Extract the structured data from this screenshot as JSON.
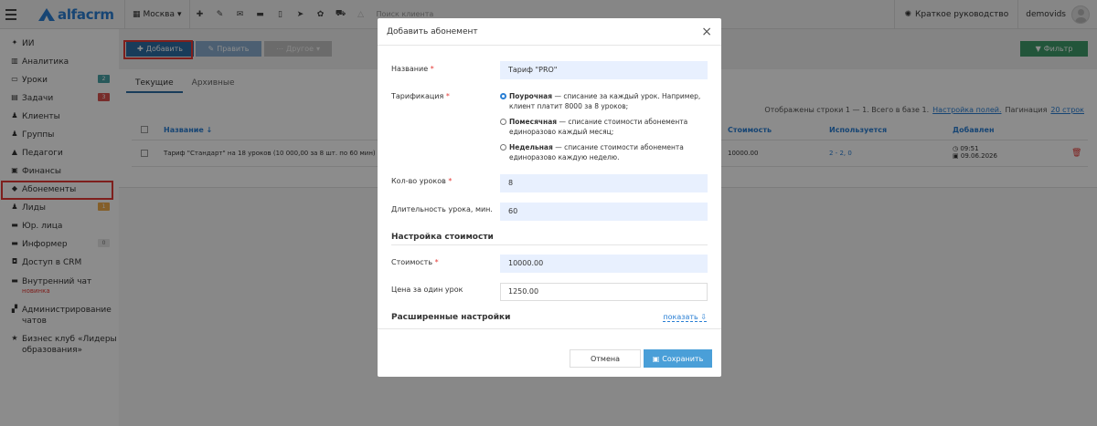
{
  "header": {
    "logo_text": "alfacrm",
    "city": "Москва",
    "city_caret": "▾",
    "search_placeholder": "Поиск клиента",
    "guide": "Краткое руководство",
    "user": "demovids"
  },
  "sidebar": {
    "items": [
      {
        "icon": "✦",
        "label": "ИИ"
      },
      {
        "icon": "▥",
        "label": "Аналитика"
      },
      {
        "icon": "▭",
        "label": "Уроки",
        "badge": "2"
      },
      {
        "icon": "▤",
        "label": "Задачи",
        "badge": "3"
      },
      {
        "icon": "♟",
        "label": "Клиенты"
      },
      {
        "icon": "♟",
        "label": "Группы"
      },
      {
        "icon": "▲",
        "label": "Педагоги"
      },
      {
        "icon": "▣",
        "label": "Финансы"
      },
      {
        "icon": "◆",
        "label": "Абонементы"
      },
      {
        "icon": "♟",
        "label": "Лиды",
        "badge": "1"
      },
      {
        "icon": "▬",
        "label": "Юр. лица"
      },
      {
        "icon": "▬",
        "label": "Информер",
        "badge": "0"
      },
      {
        "icon": "◘",
        "label": "Доступ в CRM"
      },
      {
        "icon": "▬",
        "label": "Внутренний чат",
        "sub": "новинка"
      },
      {
        "icon": "▞",
        "label": "Администрирование чатов"
      },
      {
        "icon": "★",
        "label": "Бизнес клуб «Лидеры образования»"
      }
    ]
  },
  "toolbar": {
    "add": "Добавить",
    "edit": "Править",
    "other": "Другое",
    "filter": "Фильтр"
  },
  "tabs": [
    "Текущие",
    "Архивные"
  ],
  "table_info": {
    "shown": "Отображены строки 1 — 1. Всего в базе 1.",
    "fields_link": "Настройка полей.",
    "pagination": "Пагинация",
    "pagination_value": "20 строк"
  },
  "table": {
    "headers": {
      "name": "Название ↓",
      "price": "Стоимость",
      "used": "Используется",
      "added": "Добавлен"
    },
    "row": {
      "name": "Тариф \"Стандарт\" на 18 уроков (10 000,00 за 8 шт. по 60 мин)",
      "price": "10000.00",
      "used_prefix": "2 - ",
      "used_link": "2",
      "used_suffix": ", 0",
      "time": "09:51",
      "date": "09.06.2026"
    }
  },
  "modal": {
    "title": "Добавить абонемент",
    "close": "×",
    "name_label": "Название",
    "name_value": "Тариф \"PRO\"",
    "tarif_label": "Тарификация",
    "opt1_bold": "Поурочная",
    "opt1_text": " — списание за каждый урок. Например, клиент платит 8000 за 8 уроков;",
    "opt2_bold": "Помесячная",
    "opt2_text": " — списание стоимости абонемента единоразово каждый месяц;",
    "opt3_bold": "Недельная",
    "opt3_text": " — списание стоимости абонемента единоразово каждую неделю.",
    "lessons_label": "Кол-во уроков",
    "lessons_value": "8",
    "duration_label": "Длительность урока, мин.",
    "duration_value": "60",
    "cost_section": "Настройка стоимости",
    "cost_label": "Стоимость",
    "cost_value": "10000.00",
    "per_lesson_label": "Цена за один урок",
    "per_lesson_value": "1250.00",
    "advanced": "Расширенные настройки",
    "show": "показать ⇩",
    "cancel": "Отмена",
    "save": "Сохранить",
    "required_mark": "*"
  },
  "colors": {
    "primary": "#2e6da4",
    "accent_red": "#e53935",
    "filter_green": "#3e9c6a",
    "save_blue": "#4a9fd8"
  }
}
